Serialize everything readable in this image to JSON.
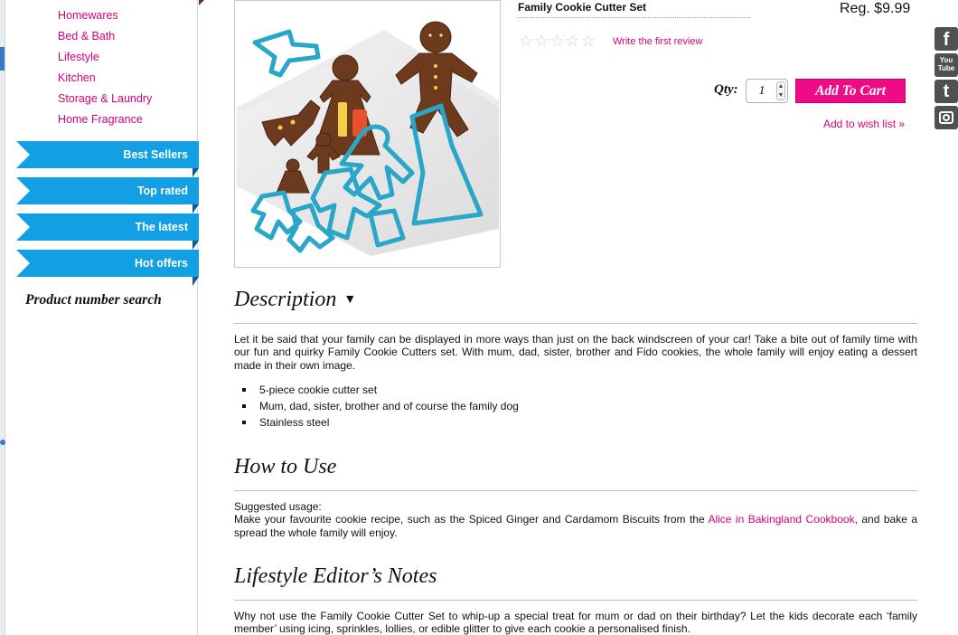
{
  "sidebar": {
    "categories": [
      "Homewares",
      "Bed & Bath",
      "Lifestyle",
      "Kitchen",
      "Storage & Laundry",
      "Home Fragrance"
    ],
    "ribbons": [
      "Best Sellers",
      "Top rated",
      "The latest",
      "Hot offers"
    ],
    "product_number_search": "Product number search"
  },
  "product": {
    "title": "Family Cookie Cutter Set",
    "price": "Reg. $9.99",
    "rating_stars": 0,
    "review_link": "Write the first review",
    "qty_label": "Qty:",
    "qty_value": "1",
    "add_to_cart": "Add To Cart",
    "wishlist": "Add to wish list »"
  },
  "social": [
    "facebook-icon",
    "youtube-icon",
    "twitter-icon",
    "instagram-icon"
  ],
  "social_labels": {
    "facebook": "f",
    "youtube_top": "You",
    "youtube_bottom": "Tube",
    "twitter": "t"
  },
  "description": {
    "title": "Description",
    "arrow": "▼",
    "text": "Let it be said that your family can be displayed in more ways than just on the back windscreen of your car! Take a bite out of family time with our fun and quirky Family Cookie Cutters set. With mum, dad, sister, brother and Fido cookies, the whole family will enjoy eating a dessert made in their own image.",
    "bullets": [
      "5-piece cookie cutter set",
      "Mum, dad, sister, brother and of course the family dog",
      "Stainless steel"
    ]
  },
  "how_to_use": {
    "title": "How to Use",
    "line1": "Suggested usage:",
    "text_before": "Make your favourite cookie recipe, such as the Spiced Ginger and Cardamom Biscuits from the ",
    "link": "Alice in Bakingland Cookbook",
    "text_after": ", and bake a spread the whole family will enjoy."
  },
  "editors_notes": {
    "title": "Lifestyle Editor’s Notes",
    "text": "Why not use the Family Cookie Cutter Set to whip-up a special treat for mum or dad on their birthday? Let the kids decorate each ‘family member’ using icing, sprinkles, lollies, or edible glitter to give each cookie a personalised finish."
  },
  "colors": {
    "accent_pink": "#d6007a",
    "cart_pink": "#ef0a86",
    "ribbon_blue": "#139fe3"
  }
}
